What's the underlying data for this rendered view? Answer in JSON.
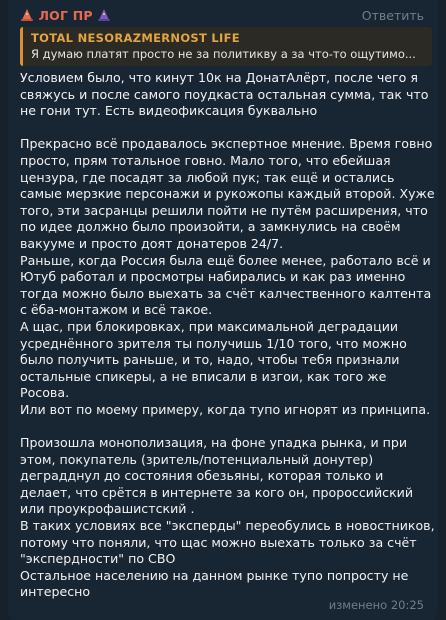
{
  "header": {
    "author": "ЛОГ ПР",
    "reply_label": "Ответить",
    "icon_left": "wizard-hat-icon",
    "icon_right": "wizard-hat-icon",
    "author_color": "#e56a54"
  },
  "quote": {
    "author": "TOTAL NESORAZMERNOST LIFE",
    "text": "Я думаю платят просто не за политикву а за что-то ощутимо...",
    "accent_color": "#d89233"
  },
  "message": {
    "paragraphs": [
      "Условием было, что кинут 10к на ДонатАлёрт, после чего я свяжусь и после самого поудкаста остальная сумма, так что не гони тут. Есть видеофиксация буквально",
      "",
      "Прекрасно всё продавалось экспертное мнение. Время говно просто, прям тотальное говно. Мало того, что ебейшая цензура, где посадят за любой пук; так ещё и остались самые мерзкие персонажи и рукожопы каждый второй. Хуже того, эти засранцы решили пойти не путём расширения, что по идее должно было произойти, а замкнулись на своём вакууме и просто доят донатеров 24/7.",
      "Раньше, когда Россия была ещё более менее, работало всё и Ютуб работал и просмотры набирались и как раз именно тогда можно было выехать за счёт калчественного калтента с ёба-монтажом и всё такое.",
      "А щас, при блокировках, при максимальной деградации усреднённого зрителя ты получишь 1/10 того, что можно было получить раньше, и то, надо, чтобы тебя признали остальные спикеры, а не вписали в изгои, как того же Росова.",
      "Или вот по моему примеру, когда тупо игнорят из принципа.",
      "",
      "Произошла монополизация, на фоне упадка рынка, и при этом, покупатель (зритель/потенциальный донутер) деградднул до состояния обезьяны, которая только и делает, что срётся в интернете за кого он, пророссийский или проукрофашистский .",
      "В таких условиях все \"эксперды\" переобулись в новостников, потому что поняли, что щас можно выехать только за счёт \"экспердности\" по СВО",
      "Остальное населению на данном рынке тупо попросту не интересно"
    ]
  },
  "meta": {
    "edited_label": "изменено",
    "time": "20:25"
  }
}
